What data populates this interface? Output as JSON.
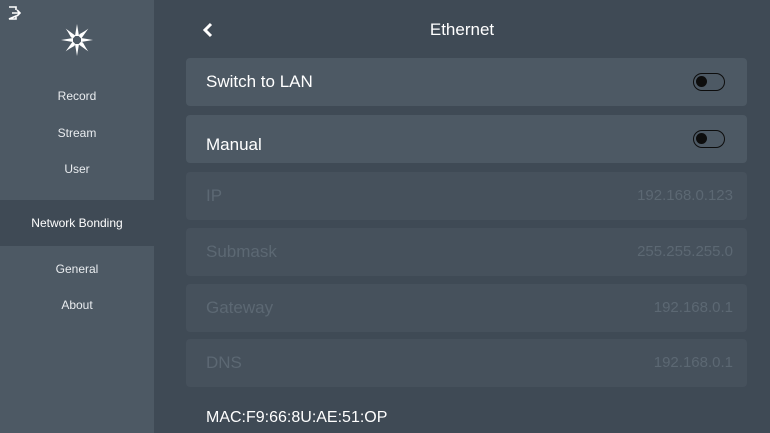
{
  "sidebar": {
    "items": [
      {
        "label": "Record"
      },
      {
        "label": "Stream"
      },
      {
        "label": "User"
      },
      {
        "label": "Network Bonding"
      },
      {
        "label": "General"
      },
      {
        "label": "About"
      }
    ],
    "active_item": "Network Bonding",
    "logo_icon": "snowflake-logo",
    "exit_icon": "exit-icon"
  },
  "header": {
    "title": "Ethernet",
    "back_icon": "chevron-left-icon"
  },
  "toggles": {
    "switch_to_lan": {
      "label": "Switch to LAN",
      "on": false
    },
    "manual": {
      "label": "Manual",
      "on": false
    }
  },
  "fields": [
    {
      "label": "IP",
      "value": "192.168.0.123"
    },
    {
      "label": "Submask",
      "value": "255.255.255.0"
    },
    {
      "label": "Gateway",
      "value": "192.168.0.1"
    },
    {
      "label": "DNS",
      "value": "192.168.0.1"
    }
  ],
  "mac": "MAC:F9:66:8U:AE:51:OP",
  "colors": {
    "background": "#3f4a55",
    "sidebar": "#4d5964",
    "row": "#4d5964",
    "disabled_field": "#46515c",
    "disabled_text": "#5c6873"
  }
}
